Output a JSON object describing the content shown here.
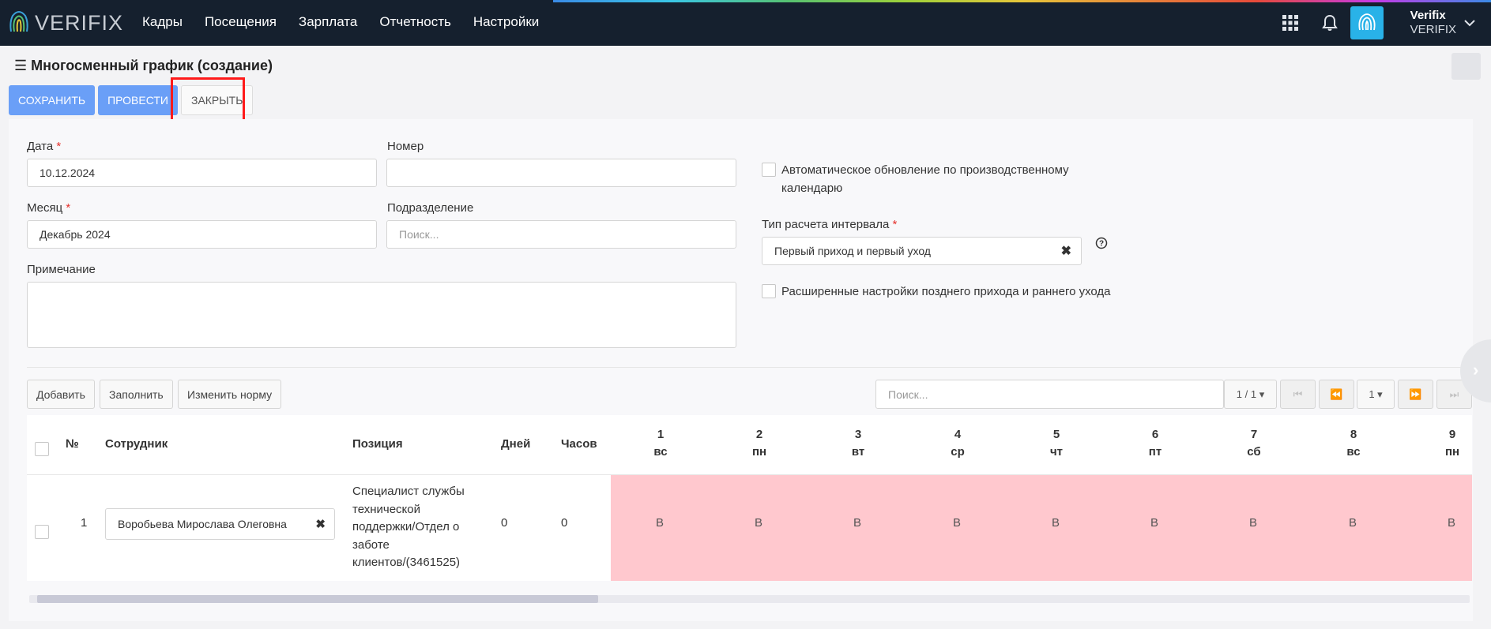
{
  "brand": {
    "logo_text": "VERIFIX"
  },
  "nav": [
    "Кадры",
    "Посещения",
    "Зарплата",
    "Отчетность",
    "Настройки"
  ],
  "user": {
    "name": "Verifix",
    "company": "VERIFIX"
  },
  "icons": {
    "apps": "grid-icon",
    "notifications": "bell-icon",
    "fingerprint": "fingerprint-icon",
    "menu": "hamburger-icon",
    "user_menu": "chevron-down-icon"
  },
  "page": {
    "title": "Многосменный график (создание)"
  },
  "toolbar": {
    "save": "СОХРАНИТЬ",
    "post": "ПРОВЕСТИ",
    "close": "ЗАКРЫТЬ"
  },
  "form": {
    "date_label": "Дата",
    "date_value": "10.12.2024",
    "number_label": "Номер",
    "number_value": "",
    "month_label": "Месяц",
    "month_value": "Декабрь 2024",
    "division_label": "Подразделение",
    "division_placeholder": "Поиск...",
    "note_label": "Примечание",
    "note_value": "",
    "auto_update_label_line1": "Автоматическое обновление по производственному",
    "auto_update_label_line2": "календарю",
    "interval_label": "Тип расчета интервала",
    "interval_value": "Первый приход и первый уход",
    "extended_label": "Расширенные настройки позднего прихода и раннего ухода",
    "required_mark": "*"
  },
  "table_toolbar": {
    "add": "Добавить",
    "fill": "Заполнить",
    "change_norm": "Изменить норму",
    "search_placeholder": "Поиск...",
    "page_info": "1 / 1",
    "page_size": "1"
  },
  "table": {
    "headers": {
      "num": "№",
      "employee": "Сотрудник",
      "position": "Позиция",
      "days": "Дней",
      "hours": "Часов"
    },
    "days": [
      {
        "d": "1",
        "w": "вс"
      },
      {
        "d": "2",
        "w": "пн"
      },
      {
        "d": "3",
        "w": "вт"
      },
      {
        "d": "4",
        "w": "ср"
      },
      {
        "d": "5",
        "w": "чт"
      },
      {
        "d": "6",
        "w": "пт"
      },
      {
        "d": "7",
        "w": "сб"
      },
      {
        "d": "8",
        "w": "вс"
      },
      {
        "d": "9",
        "w": "пн"
      }
    ],
    "rows": [
      {
        "num": "1",
        "employee": "Воробьева Мирослава Олеговна",
        "position_lines": [
          "Специалист службы",
          "технической",
          "поддержки/Отдел о",
          "заботе",
          "клиентов/(3461525)"
        ],
        "days": "0",
        "hours": "0",
        "cells": [
          "В",
          "В",
          "В",
          "В",
          "В",
          "В",
          "В",
          "В",
          "В"
        ]
      }
    ]
  },
  "colors": {
    "topbar": "#15202e",
    "primary": "#6a9ff7",
    "weekend_cell": "#ffc8ce",
    "highlight": "#ff1a1a"
  }
}
